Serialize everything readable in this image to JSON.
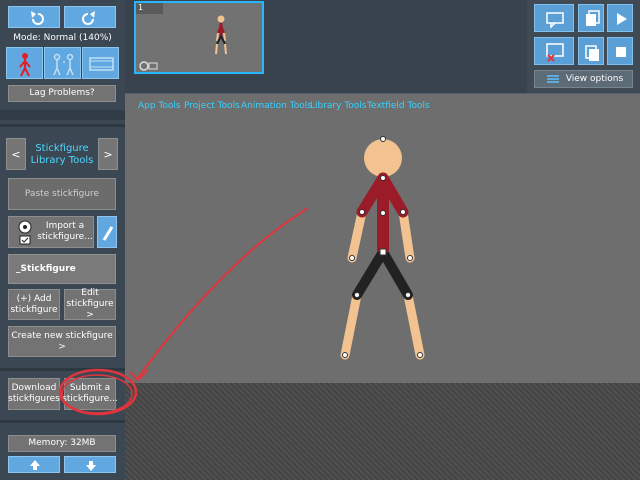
{
  "left": {
    "mode_text": "Mode: Normal (140%)",
    "lag_button": "Lag Problems?",
    "library": {
      "prev": "<",
      "next": ">",
      "title_line1": "Stickfigure",
      "title_line2": "Library Tools"
    },
    "paste_button": "Paste stickfigure",
    "import_button_line1": "Import a",
    "import_button_line2": "stickfigure...",
    "name_field_value": "_Stickfigure",
    "add_button_line1": "(+) Add",
    "add_button_line2": "stickfigure",
    "edit_button_line1": "Edit",
    "edit_button_line2": "stickfigure >",
    "create_button": "Create new stickfigure >",
    "download_button_line1": "Download",
    "download_button_line2": "stickfigures",
    "submit_button_line1": "Submit a",
    "submit_button_line2": "stickfigure...",
    "memory_text": "Memory: 32MB"
  },
  "timeline": {
    "frame_number": "1"
  },
  "right": {
    "view_options": "View options"
  },
  "tabs": [
    "App Tools",
    "Project Tools",
    "Animation Tools",
    "Library Tools",
    "Textfield Tools"
  ],
  "colors": {
    "accent": "#4dd8ff",
    "button_blue": "#5aa0d7",
    "torso": "#9b1c28",
    "skin": "#f2c291",
    "annotation": "#e0353d"
  },
  "icons": [
    "undo-icon",
    "redo-icon",
    "stickfigure-icon",
    "onion-skin-icon",
    "film-icon",
    "chat-icon",
    "copy-icon",
    "play-icon",
    "delete-icon",
    "copy-frame-icon",
    "stop-icon",
    "list-icon",
    "soccer-ball-icon",
    "pencil-icon",
    "arrow-up-icon",
    "arrow-down-icon"
  ]
}
